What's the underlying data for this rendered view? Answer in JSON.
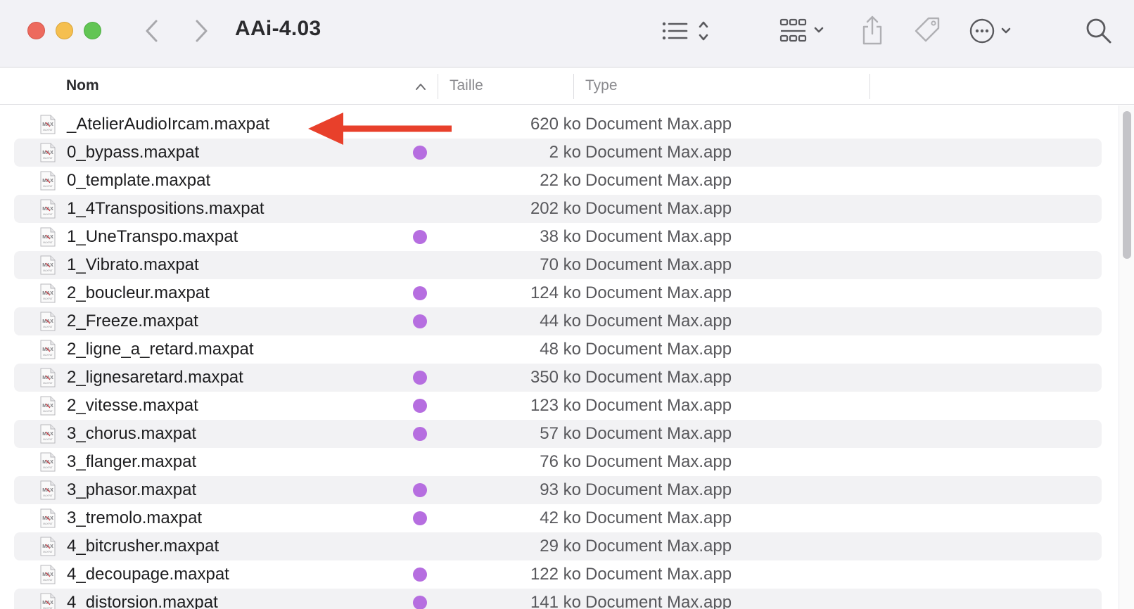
{
  "window": {
    "title": "AAi-4.03"
  },
  "toolbar": {
    "back_icon": "chevron-left-icon",
    "forward_icon": "chevron-right-icon",
    "list_view_icon": "list-view-icon",
    "group_icon": "icon-grid-icon",
    "share_icon": "share-icon",
    "tag_icon": "tag-icon",
    "more_icon": "ellipsis-circle-icon",
    "search_icon": "search-icon"
  },
  "columns": {
    "name": "Nom",
    "size": "Taille",
    "type": "Type",
    "sort_direction": "ascending"
  },
  "colors": {
    "tag_purple": "#b66ee0",
    "annotation_red": "#e8402b",
    "row_alt": "#f2f2f4"
  },
  "files": [
    {
      "name": "_AtelierAudioIrcam.maxpat",
      "size": "620 ko",
      "type": "Document Max.app",
      "tag": false
    },
    {
      "name": "0_bypass.maxpat",
      "size": "2 ko",
      "type": "Document Max.app",
      "tag": true
    },
    {
      "name": "0_template.maxpat",
      "size": "22 ko",
      "type": "Document Max.app",
      "tag": false
    },
    {
      "name": "1_4Transpositions.maxpat",
      "size": "202 ko",
      "type": "Document Max.app",
      "tag": false
    },
    {
      "name": "1_UneTranspo.maxpat",
      "size": "38 ko",
      "type": "Document Max.app",
      "tag": true
    },
    {
      "name": "1_Vibrato.maxpat",
      "size": "70 ko",
      "type": "Document Max.app",
      "tag": false
    },
    {
      "name": "2_boucleur.maxpat",
      "size": "124 ko",
      "type": "Document Max.app",
      "tag": true
    },
    {
      "name": "2_Freeze.maxpat",
      "size": "44 ko",
      "type": "Document Max.app",
      "tag": true
    },
    {
      "name": "2_ligne_a_retard.maxpat",
      "size": "48 ko",
      "type": "Document Max.app",
      "tag": false
    },
    {
      "name": "2_lignesaretard.maxpat",
      "size": "350 ko",
      "type": "Document Max.app",
      "tag": true
    },
    {
      "name": "2_vitesse.maxpat",
      "size": "123 ko",
      "type": "Document Max.app",
      "tag": true
    },
    {
      "name": "3_chorus.maxpat",
      "size": "57 ko",
      "type": "Document Max.app",
      "tag": true
    },
    {
      "name": "3_flanger.maxpat",
      "size": "76 ko",
      "type": "Document Max.app",
      "tag": false
    },
    {
      "name": "3_phasor.maxpat",
      "size": "93 ko",
      "type": "Document Max.app",
      "tag": true
    },
    {
      "name": "3_tremolo.maxpat",
      "size": "42 ko",
      "type": "Document Max.app",
      "tag": true
    },
    {
      "name": "4_bitcrusher.maxpat",
      "size": "29 ko",
      "type": "Document Max.app",
      "tag": false
    },
    {
      "name": "4_decoupage.maxpat",
      "size": "122 ko",
      "type": "Document Max.app",
      "tag": true
    },
    {
      "name": "4_distorsion.maxpat",
      "size": "141 ko",
      "type": "Document Max.app",
      "tag": true
    }
  ],
  "doc_icon": {
    "glyph": "MAX",
    "caption": "MAXPAT"
  }
}
